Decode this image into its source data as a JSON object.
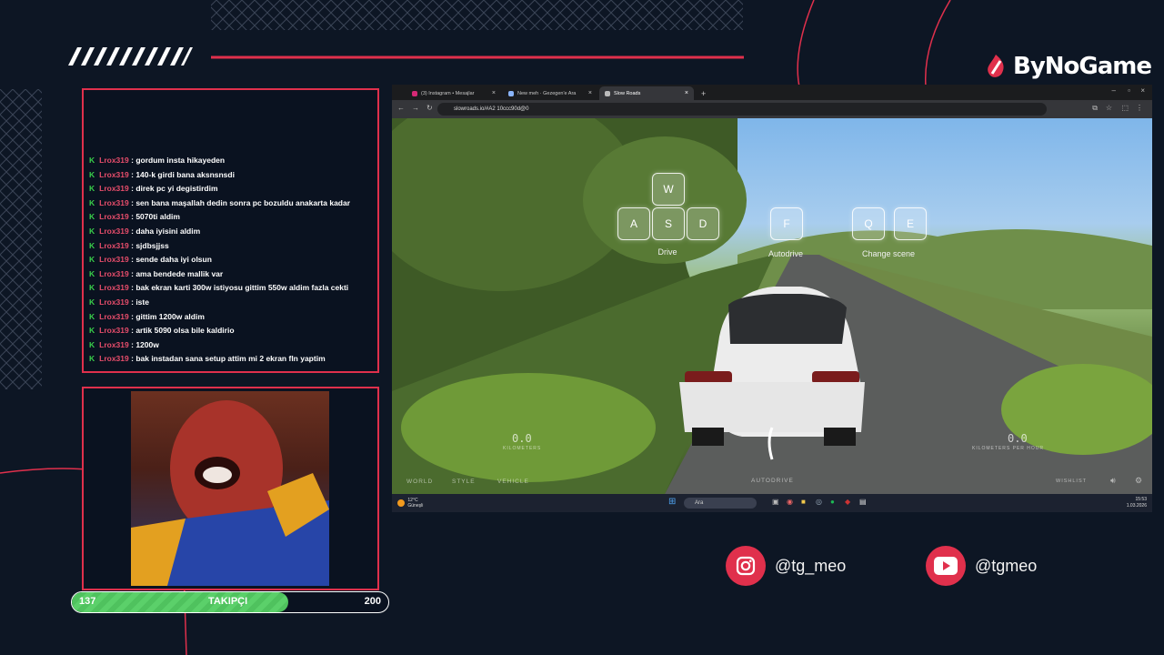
{
  "brand": {
    "name": "ByNoGame"
  },
  "chat": {
    "messages": [
      {
        "user": "Lrox319",
        "text": "gordum insta hikayeden"
      },
      {
        "user": "Lrox319",
        "text": "140-k girdi bana aksnsnsdi"
      },
      {
        "user": "Lrox319",
        "text": "direk pc yi degistirdim"
      },
      {
        "user": "Lrox319",
        "text": "sen bana maşallah dedin sonra pc bozuldu anakarta kadar"
      },
      {
        "user": "Lrox319",
        "text": "5070ti aldim"
      },
      {
        "user": "Lrox319",
        "text": "daha iyisini aldim"
      },
      {
        "user": "Lrox319",
        "text": "sjdbsjjss"
      },
      {
        "user": "Lrox319",
        "text": "sende daha iyi olsun"
      },
      {
        "user": "Lrox319",
        "text": "ama bendede mallik var"
      },
      {
        "user": "Lrox319",
        "text": "bak ekran karti 300w istiyosu gittim 550w aldim fazla cekti"
      },
      {
        "user": "Lrox319",
        "text": "iste"
      },
      {
        "user": "Lrox319",
        "text": "gittim 1200w aldim"
      },
      {
        "user": "Lrox319",
        "text": "artik 5090 olsa bile kaldirio"
      },
      {
        "user": "Lrox319",
        "text": "1200w"
      },
      {
        "user": "Lrox319",
        "text": "bak instadan sana setup attim mi 2 ekran fln yaptim"
      }
    ]
  },
  "followers": {
    "current": "137",
    "label": "TAKIPÇI",
    "goal": "200",
    "progress": 0.685
  },
  "browser": {
    "tabs": [
      {
        "title": "(3) Instagram • Mesajlar",
        "color": "#d62976"
      },
      {
        "title": "New meh · Gezegen'e Ara",
        "color": "#8ab4f8"
      },
      {
        "title": "Slow Roads",
        "color": "#bbbbbb"
      }
    ],
    "new_tab": "+",
    "url": "slowroads.io/#A2 10ccc90d@0"
  },
  "game": {
    "keys": {
      "w": "W",
      "a": "A",
      "s": "S",
      "d": "D",
      "f": "F",
      "q": "Q",
      "e": "E"
    },
    "labels": {
      "drive": "Drive",
      "autodrive": "Autodrive",
      "change_scene": "Change scene"
    },
    "hud": {
      "left_value": "0.0",
      "left_unit": "KILOMETERS",
      "right_value": "0.0",
      "right_unit": "KILOMETERS PER HOUR",
      "tabs": [
        "WORLD",
        "STYLE",
        "VEHICLE"
      ],
      "center": "AUTODRIVE",
      "wishlist": "WISHLIST"
    }
  },
  "taskbar": {
    "weather_temp": "12°C",
    "weather_desc": "Güneşli",
    "search": "Ara",
    "time": "15:53",
    "date": "1.03.2026"
  },
  "socials": {
    "instagram": "@tg_meo",
    "youtube": "@tgmeo"
  },
  "colors": {
    "accent": "#e0304c",
    "background": "#0d1624",
    "green": "#4fc25e"
  }
}
